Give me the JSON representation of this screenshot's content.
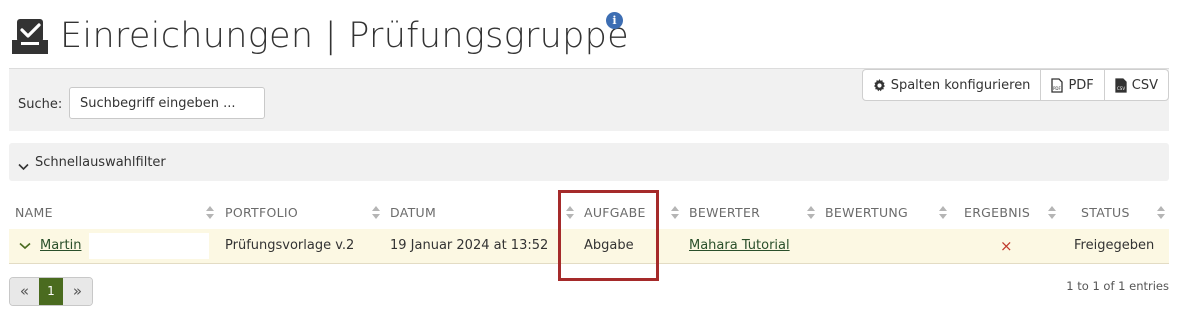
{
  "header": {
    "title": "Einreichungen | Prüfungsgruppe",
    "title_icon": "inbox-check-icon",
    "info_icon": "info-icon",
    "info_glyph": "i"
  },
  "search": {
    "label": "Suche:",
    "placeholder": "Suchbegriff eingeben ..."
  },
  "toolbar": {
    "configure_label": "Spalten konfigurieren",
    "pdf_label": "PDF",
    "csv_label": "CSV"
  },
  "filter": {
    "label": "Schnellauswahlfilter"
  },
  "table": {
    "columns": [
      "NAME",
      "PORTFOLIO",
      "DATUM",
      "AUFGABE",
      "BEWERTER",
      "BEWERTUNG",
      "ERGEBNIS",
      "STATUS"
    ],
    "rows": [
      {
        "name": "Martin",
        "portfolio": "Prüfungsvorlage v.2",
        "date": "19 Januar 2024 at 13:52",
        "task": "Abgabe",
        "assessor": "Mahara Tutorial",
        "grade": "",
        "result": "×",
        "status": "Freigegeben"
      }
    ]
  },
  "pagination": {
    "prev": "«",
    "current": "1",
    "next": "»",
    "summary": "1 to 1 of 1 entries"
  },
  "colors": {
    "row_highlight": "#fcf8e3",
    "annotation_box": "#a52a2a",
    "pager_active": "#4a6b1f",
    "result_x": "#c0392b"
  }
}
